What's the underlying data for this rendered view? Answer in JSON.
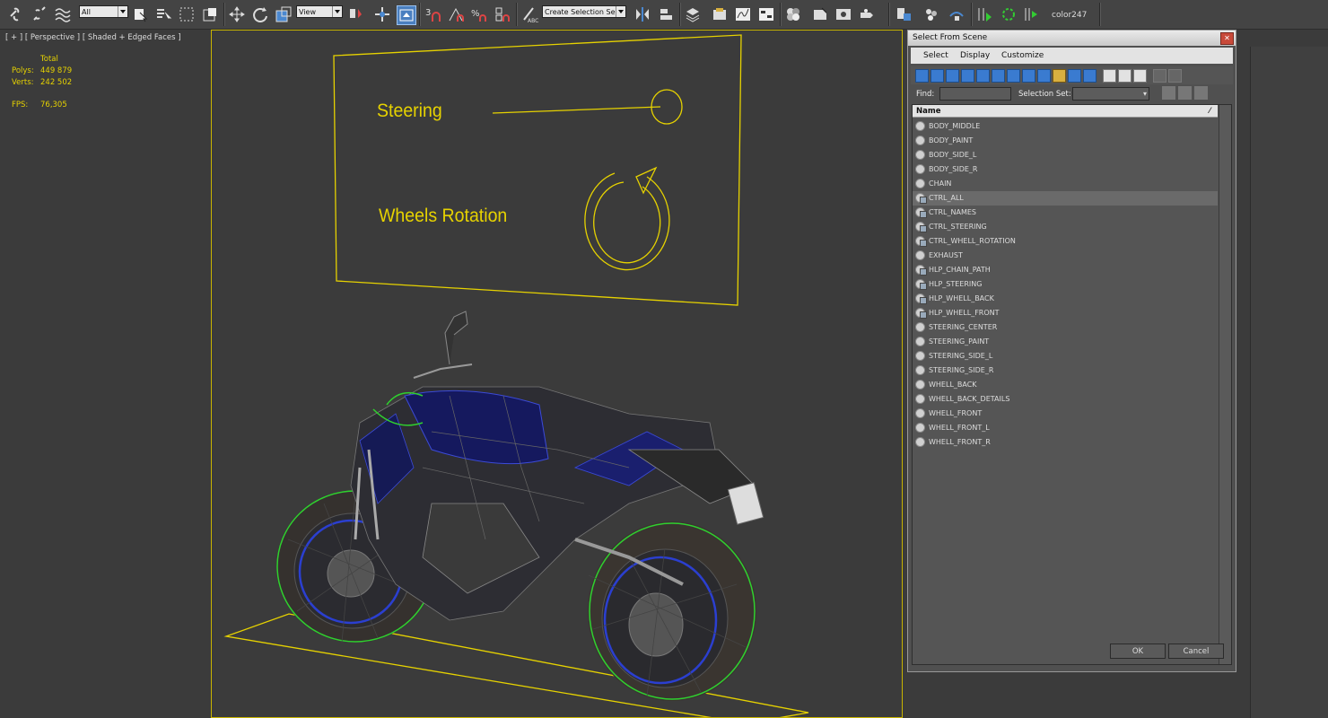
{
  "toolbar": {
    "selection_filter": "All",
    "reference_coord": "View",
    "selection_set_placeholder": "Create Selection Se",
    "color_label": "color247"
  },
  "viewport": {
    "label": "[ + ] [ Perspective ] [ Shaded + Edged Faces ]",
    "stats": {
      "total_label": "Total",
      "polys_label": "Polys:",
      "polys_value": "449 879",
      "verts_label": "Verts:",
      "verts_value": "242 502",
      "fps_label": "FPS:",
      "fps_value": "76,305"
    },
    "board": {
      "steering_label": "Steering",
      "wheels_label": "Wheels Rotation"
    }
  },
  "dialog": {
    "title": "Select From Scene",
    "menus": [
      "Select",
      "Display",
      "Customize"
    ],
    "find_label": "Find:",
    "selection_set_label": "Selection Set:",
    "column_header": "Name",
    "items": [
      {
        "name": "BODY_MIDDLE",
        "kind": "geometry"
      },
      {
        "name": "BODY_PAINT",
        "kind": "geometry"
      },
      {
        "name": "BODY_SIDE_L",
        "kind": "geometry"
      },
      {
        "name": "BODY_SIDE_R",
        "kind": "geometry"
      },
      {
        "name": "CHAIN",
        "kind": "geometry"
      },
      {
        "name": "CTRL_ALL",
        "kind": "helper",
        "selected": true
      },
      {
        "name": "CTRL_NAMES",
        "kind": "helper"
      },
      {
        "name": "CTRL_STEERING",
        "kind": "helper"
      },
      {
        "name": "CTRL_WHELL_ROTATION",
        "kind": "helper"
      },
      {
        "name": "EXHAUST",
        "kind": "geometry"
      },
      {
        "name": "HLP_CHAIN_PATH",
        "kind": "helper"
      },
      {
        "name": "HLP_STEERING",
        "kind": "helper"
      },
      {
        "name": "HLP_WHELL_BACK",
        "kind": "helper"
      },
      {
        "name": "HLP_WHELL_FRONT",
        "kind": "helper"
      },
      {
        "name": "STEERING_CENTER",
        "kind": "geometry"
      },
      {
        "name": "STEERING_PAINT",
        "kind": "geometry"
      },
      {
        "name": "STEERING_SIDE_L",
        "kind": "geometry"
      },
      {
        "name": "STEERING_SIDE_R",
        "kind": "geometry"
      },
      {
        "name": "WHELL_BACK",
        "kind": "geometry"
      },
      {
        "name": "WHELL_BACK_DETAILS",
        "kind": "geometry"
      },
      {
        "name": "WHELL_FRONT",
        "kind": "geometry"
      },
      {
        "name": "WHELL_FRONT_L",
        "kind": "geometry"
      },
      {
        "name": "WHELL_FRONT_R",
        "kind": "geometry"
      }
    ],
    "ok_label": "OK",
    "cancel_label": "Cancel"
  },
  "colors": {
    "accent_yellow": "#e6d200",
    "selection_green": "#2fd02f",
    "bike_blue": "#1e2a8a"
  }
}
